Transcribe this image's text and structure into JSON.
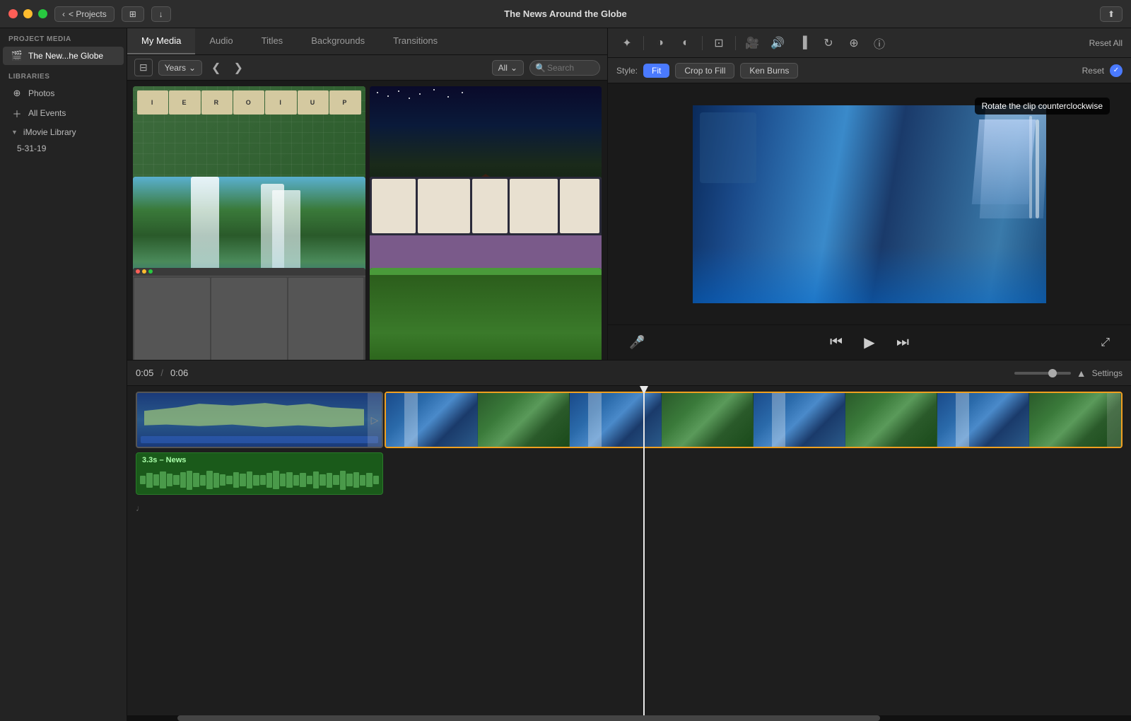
{
  "app": {
    "title": "The News Around the Globe"
  },
  "titlebar": {
    "projects_btn": "< Projects",
    "reset_all_btn": "Reset All"
  },
  "media_tabs": {
    "my_media": "My Media",
    "audio": "Audio",
    "titles": "Titles",
    "backgrounds": "Backgrounds",
    "transitions": "Transitions"
  },
  "sidebar": {
    "project_media_header": "PROJECT MEDIA",
    "project_item": "The New...he Globe",
    "libraries_header": "LIBRARIES",
    "photos_item": "Photos",
    "all_events_item": "All Events",
    "imovie_library_item": "iMovie Library",
    "date_item": "5-31-19"
  },
  "media_toolbar": {
    "years_label": "Years",
    "all_label": "All",
    "search_placeholder": "Search"
  },
  "style_bar": {
    "style_label": "Style:",
    "fit_btn": "Fit",
    "crop_to_fill_btn": "Crop to Fill",
    "ken_burns_btn": "Ken Burns",
    "reset_btn": "Reset"
  },
  "tooltip": {
    "text": "Rotate the clip counterclockwise"
  },
  "playback": {
    "timecode_current": "0:05",
    "timecode_divider": "/",
    "timecode_total": "0:06"
  },
  "timeline": {
    "settings_btn": "Settings"
  },
  "audio_clip": {
    "label": "3.3s – News"
  },
  "thumbnails": [
    {
      "id": "scrabble",
      "type": "scrabble"
    },
    {
      "id": "night-house",
      "type": "night"
    },
    {
      "id": "waterfall",
      "type": "waterfall"
    },
    {
      "id": "purple",
      "type": "purple"
    },
    {
      "id": "screenshot1",
      "type": "screenshot"
    },
    {
      "id": "green",
      "type": "green"
    }
  ]
}
